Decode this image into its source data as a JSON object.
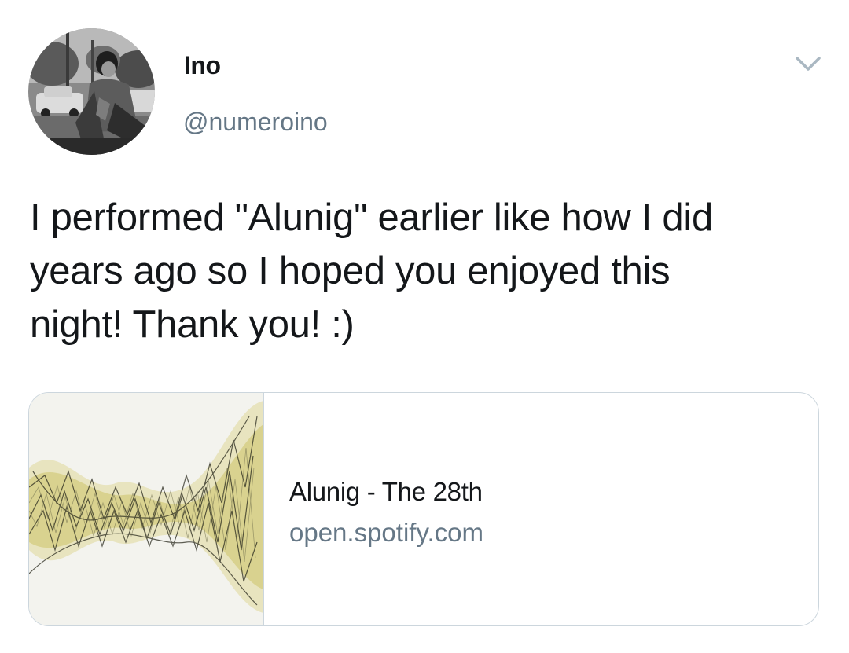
{
  "tweet": {
    "display_name": "Ino",
    "handle": "@numeroino",
    "text": "I performed \"Alunig\" earlier like how I did\nyears ago so I hoped you enjoyed this\nnight! Thank you! :)",
    "menu_icon": "chevron-down-icon"
  },
  "card": {
    "title": "Alunig - The 28th",
    "domain": "open.spotify.com"
  },
  "colors": {
    "text_primary": "#14171a",
    "text_secondary": "#657786",
    "border": "#ccd6dd",
    "caret": "#aab8c2"
  }
}
